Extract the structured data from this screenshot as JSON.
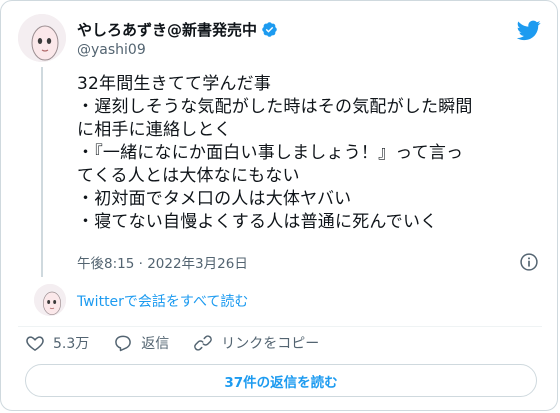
{
  "user": {
    "display_name": "やしろあずき@新書発売中",
    "handle": "@yashi09"
  },
  "tweet": {
    "lines": [
      "32年間生きてて学んだ事",
      "・遅刻しそうな気配がした時はその気配がした瞬間",
      "に相手に連絡しとく",
      "・『一緒になにか面白い事しましょう！』って言っ",
      "てくる人とは大体なにもない",
      "・初対面でタメ口の人は大体ヤバい",
      "・寝てない自慢よくする人は普通に死んでいく"
    ],
    "timestamp": "午後8:15 · 2022年3月26日"
  },
  "thread_link": "Twitterで会話をすべて読む",
  "actions": {
    "like_count": "5.3万",
    "reply_label": "返信",
    "copy_link_label": "リンクをコピー"
  },
  "replies_button": "37件の返信を読む",
  "colors": {
    "accent": "#1d9bf0",
    "text": "#0f1419",
    "muted": "#536471",
    "border": "#cfd9de"
  },
  "icons": {
    "brand": "twitter-bird-icon",
    "verified": "verified-badge-icon",
    "info": "info-icon",
    "like": "heart-icon",
    "reply": "speech-bubble-icon",
    "copy_link": "link-icon"
  }
}
